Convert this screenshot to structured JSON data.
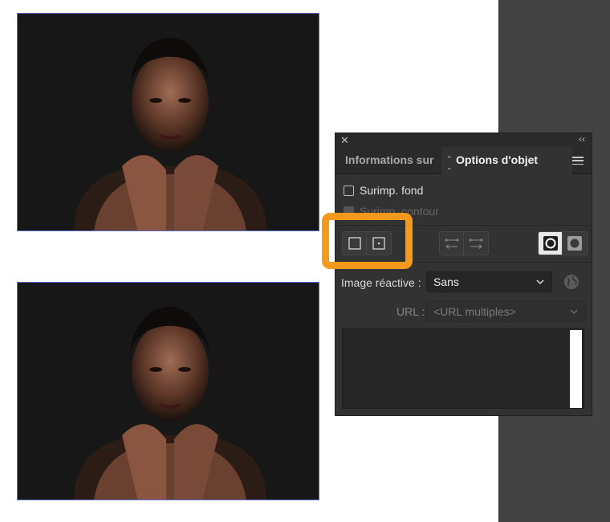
{
  "panel": {
    "close_icon": "close-icon",
    "collapse_icon": "double-chevron-icon",
    "tabs": [
      {
        "label": "Informations sur"
      },
      {
        "label": "Options d'objet"
      }
    ],
    "menu_icon": "hamburger-menu-icon",
    "checkboxes": [
      {
        "label": "Surimp. fond",
        "checked": false,
        "enabled": true
      },
      {
        "label": "Surimp. contour",
        "checked": false,
        "enabled": false
      }
    ],
    "buttons": {
      "center_point": [
        "hide-center-icon",
        "show-center-icon"
      ],
      "path_direction": [
        "reverse-path-direction-icon",
        "reverse-path-direction-alt-icon"
      ],
      "fill_rule": [
        {
          "icon": "non-zero-winding-fill-rule-icon",
          "selected": true
        },
        {
          "icon": "even-odd-fill-rule-icon",
          "selected": false
        }
      ]
    },
    "image_map": {
      "label": "Image réactive :",
      "value": "Sans",
      "browser_icon": "globe-icon"
    },
    "url": {
      "label": "URL :",
      "value": "<URL multiples>"
    },
    "notes_text": ""
  },
  "colors": {
    "highlight": "#f39a1d",
    "panel_bg": "#323232",
    "selection_border": "#5a6ad6"
  }
}
